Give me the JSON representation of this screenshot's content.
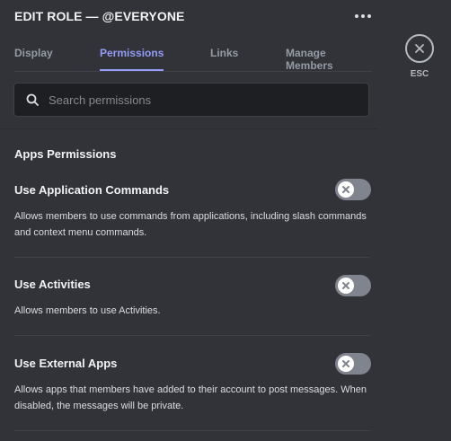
{
  "header": {
    "title": "EDIT ROLE — @EVERYONE",
    "more_icon": "more-horizontal-icon"
  },
  "tabs": [
    {
      "label": "Display",
      "active": false
    },
    {
      "label": "Permissions",
      "active": true
    },
    {
      "label": "Links",
      "active": false
    },
    {
      "label": "Manage Members",
      "active": false
    }
  ],
  "search": {
    "placeholder": "Search permissions",
    "value": "",
    "icon": "search-icon"
  },
  "section": {
    "title": "Apps Permissions"
  },
  "permissions": [
    {
      "name": "Use Application Commands",
      "description": "Allows members to use commands from applications, including slash commands and context menu commands.",
      "enabled": false
    },
    {
      "name": "Use Activities",
      "description": "Allows members to use Activities.",
      "enabled": false
    },
    {
      "name": "Use External Apps",
      "description": "Allows apps that members have added to their account to post messages. When disabled, the messages will be private.",
      "enabled": false
    }
  ],
  "close": {
    "label": "ESC",
    "icon": "close-icon"
  },
  "colors": {
    "background": "#313338",
    "accent": "#949cf7",
    "toggle_off": "#80848e",
    "input_bg": "#1e1f22"
  }
}
